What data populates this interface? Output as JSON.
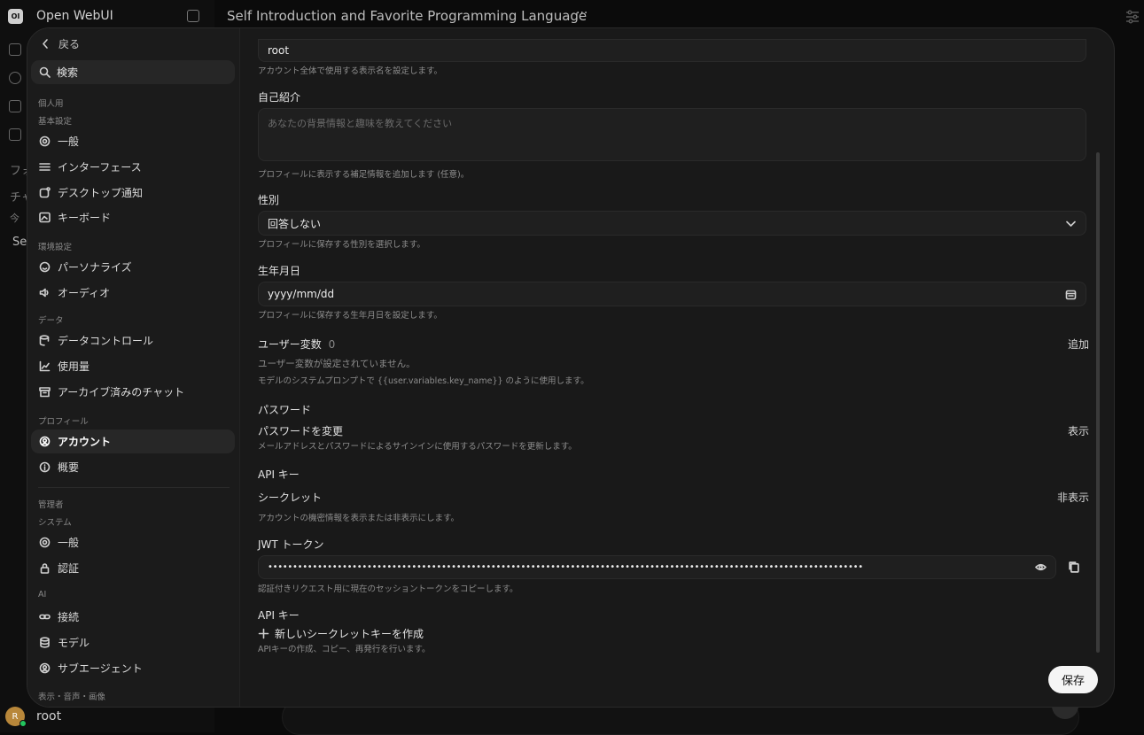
{
  "app": {
    "name": "Open WebUI",
    "logo_text": "OI"
  },
  "chat": {
    "title": "Self Introduction and Favorite Programming Language",
    "more": "···"
  },
  "bg_sidebar": {
    "letters": [
      "フォ",
      "チャ",
      "今",
      "Se"
    ]
  },
  "user": {
    "name": "root",
    "initial": "R"
  },
  "settings": {
    "back_label": "戻る",
    "search_label": "検索",
    "sections": {
      "personal": "個人用",
      "basic": "基本設定",
      "env": "環境設定",
      "data": "データ",
      "profile": "プロフィール",
      "admin": "管理者",
      "system": "システム",
      "ai": "AI",
      "display": "表示・音声・画像"
    },
    "nav": {
      "general": "一般",
      "interface": "インターフェース",
      "desktop_notify": "デスクトップ通知",
      "keyboard": "キーボード",
      "personalize": "パーソナライズ",
      "audio": "オーディオ",
      "data_control": "データコントロール",
      "usage": "使用量",
      "archived": "アーカイブ済みのチャット",
      "account": "アカウント",
      "about": "概要",
      "sys_general": "一般",
      "auth": "認証",
      "connections": "接続",
      "models": "モデル",
      "subagent": "サブエージェント"
    },
    "account": {
      "name_value": "root",
      "name_hint": "アカウント全体で使用する表示名を設定します。",
      "bio_label": "自己紹介",
      "bio_placeholder": "あなたの背景情報と趣味を教えてください",
      "bio_hint": "プロフィールに表示する補足情報を追加します (任意)。",
      "gender_label": "性別",
      "gender_value": "回答しない",
      "gender_hint": "プロフィールに保存する性別を選択します。",
      "birth_label": "生年月日",
      "birth_placeholder": "yyyy/mm/dd",
      "birth_hint": "プロフィールに保存する生年月日を設定します。",
      "vars_label": "ユーザー変数",
      "vars_count": "0",
      "vars_add": "追加",
      "vars_empty": "ユーザー変数が設定されていません。",
      "vars_usage": "モデルのシステムプロンプトで {{user.variables.key_name}} のように使用します。",
      "password_section": "パスワード",
      "password_change": "パスワードを変更",
      "password_show": "表示",
      "password_hint": "メールアドレスとパスワードによるサインインに使用するパスワードを更新します。",
      "api_section": "API キー",
      "secret_label": "シークレット",
      "secret_hide": "非表示",
      "secret_hint": "アカウントの機密情報を表示または非表示にします。",
      "jwt_label": "JWT トークン",
      "jwt_value": "••••••••••••••••••••••••••••••••••••••••••••••••••••••••••••••••••••••••••••••••••••••••••••••••••••••••••••••••••••••••",
      "jwt_hint": "認証付きリクエスト用に現在のセッショントークンをコピーします。",
      "apikey_label": "API キー",
      "apikey_create": "新しいシークレットキーを作成",
      "apikey_hint": "APIキーの作成、コピー、再発行を行います。"
    },
    "save_label": "保存"
  }
}
